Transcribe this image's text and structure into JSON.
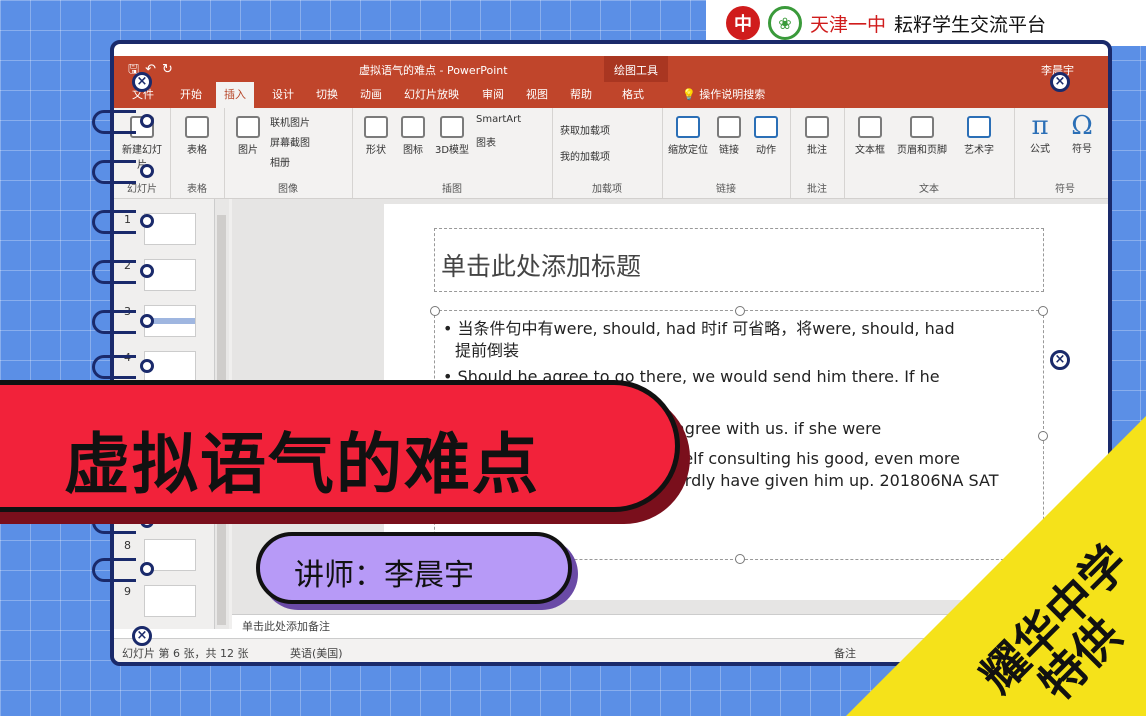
{
  "brand": {
    "school": "天津一中",
    "platform": "耘籽学生交流平台"
  },
  "ppt": {
    "window_title": "虚拟语气的难点 - PowerPoint",
    "context_tab": "绘图工具",
    "user": "李晨宇",
    "tabs": [
      "文件",
      "开始",
      "插入",
      "设计",
      "切换",
      "动画",
      "幻灯片放映",
      "审阅",
      "视图",
      "帮助",
      "格式"
    ],
    "active_tab": "插入",
    "tell_me": "操作说明搜索",
    "ribbon_groups": [
      {
        "label": "幻灯片",
        "buttons": [
          "新建幻灯片"
        ]
      },
      {
        "label": "表格",
        "buttons": [
          "表格"
        ]
      },
      {
        "label": "图像",
        "buttons": [
          "图片",
          "联机图片",
          "屏幕截图",
          "相册"
        ]
      },
      {
        "label": "插图",
        "buttons": [
          "形状",
          "图标",
          "3D模型",
          "SmartArt",
          "图表"
        ]
      },
      {
        "label": "加载项",
        "buttons": [
          "获取加载项",
          "我的加载项"
        ]
      },
      {
        "label": "链接",
        "buttons": [
          "缩放定位",
          "链接",
          "动作"
        ]
      },
      {
        "label": "批注",
        "buttons": [
          "批注"
        ]
      },
      {
        "label": "文本",
        "buttons": [
          "文本框",
          "页眉和页脚",
          "艺术字"
        ]
      },
      {
        "label": "符号",
        "buttons": [
          "公式",
          "符号"
        ]
      }
    ],
    "slide_numbers": [
      "1",
      "2",
      "3",
      "4",
      "8",
      "9"
    ],
    "slide": {
      "title_placeholder": "单击此处添加标题",
      "lines": [
        "当条件句中有were, should, had 时if 可省略，将were, should, had",
        "提前倒装",
        "Should he agree to go there, we would send him there. If he",
        "agree with us. if she were",
        "self consulting his good, even more",
        "ardly have given him up. 201806NA SAT"
      ]
    },
    "notes_placeholder": "单击此处添加备注",
    "status": {
      "slide_info": "幻灯片 第 6 张，共 12 张",
      "language": "英语(美国)",
      "notes_btn": "备注"
    }
  },
  "banner": {
    "title": "虚拟语气的难点",
    "lecturer": "讲师：李晨宇"
  },
  "corner": {
    "line1": "耀华中学",
    "line2": "特供"
  },
  "colors": {
    "background": "#5b8fe6",
    "ppt_accent": "#c0452b",
    "banner_red": "#f2223a",
    "lecturer_purple": "#b79af7",
    "corner_yellow": "#f5e21a"
  }
}
